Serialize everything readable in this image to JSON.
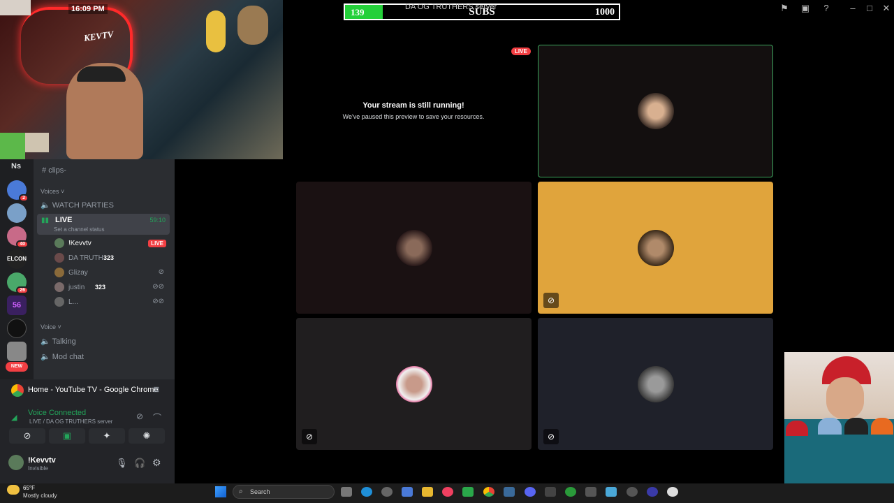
{
  "overlay": {
    "subs_current": "139",
    "subs_label": "SUBS",
    "subs_goal": "1000",
    "subs_progress": 0.139,
    "server_label": "DA OG TRUTHERS server",
    "bar_color": "#24d03a"
  },
  "webcam": {
    "time": "16:09 PM",
    "name": "KEVTV"
  },
  "servers": {
    "label": "Ns",
    "items": [
      {
        "name": "server-1",
        "badge": "2"
      },
      {
        "name": "server-2",
        "badge": ""
      },
      {
        "name": "server-3",
        "badge": "40"
      },
      {
        "name": "server-4",
        "badge": "",
        "text": "ELCON"
      },
      {
        "name": "server-5",
        "badge": "26"
      },
      {
        "name": "server-6",
        "badge": "",
        "text": "56"
      },
      {
        "name": "server-7",
        "badge": ""
      },
      {
        "name": "server-8",
        "badge": ""
      }
    ],
    "new_label": "NEW"
  },
  "channels": {
    "clips": "clips-",
    "voices_section": "Voices",
    "watch_parties": "WATCH PARTIES",
    "live_channel": "LIVE",
    "live_timer": "59:10",
    "channel_status": "Set a channel status",
    "members": [
      {
        "name": "!Kevvtv",
        "tag": "LIVE"
      },
      {
        "name": "DA TRUTH",
        "count": "323"
      },
      {
        "name": "Glizay",
        "count": ""
      },
      {
        "name": "justin",
        "count": "323"
      },
      {
        "name": "L...",
        "count": ""
      }
    ],
    "voice_section": "Voice",
    "talking": "Talking",
    "mod_chat": "Mod chat"
  },
  "panel": {
    "activity": "Home - YouTube TV - Google Chrome",
    "voice_status": "Voice Connected",
    "voice_location": "LIVE / DA OG TRUTHERS server",
    "username": "!Kevvtv",
    "user_status": "Invisible"
  },
  "stage": {
    "live_badge": "LIVE",
    "paused_title": "Your stream is still running!",
    "paused_sub": "We've paused this preview to save your resources.",
    "tile_colors": [
      "#130f0f",
      "#1a1112",
      "#e0a43c",
      "#201e1f",
      "#1f212a"
    ],
    "active_border": "#3ba55c"
  },
  "weather": {
    "temp": "65°F",
    "condition": "Mostly cloudy"
  },
  "taskbar": {
    "search_placeholder": "Search"
  }
}
